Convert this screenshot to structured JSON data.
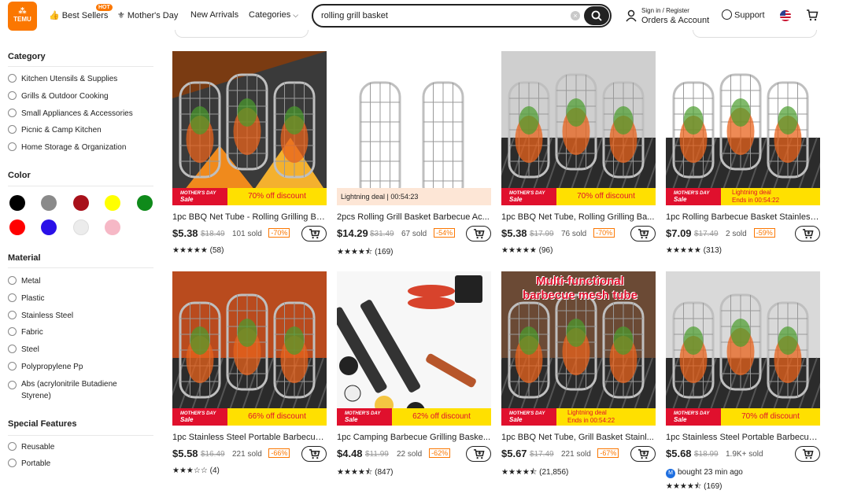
{
  "header": {
    "logo_text": "TEMU",
    "nav": {
      "best_sellers": "Best Sellers",
      "hot_badge": "HOT",
      "mothers_day": "Mother's Day",
      "new_arrivals": "New Arrivals",
      "categories": "Categories"
    },
    "search": {
      "value": "rolling grill basket"
    },
    "account": {
      "small": "Sign in / Register",
      "big": "Orders & Account"
    },
    "support": "Support"
  },
  "sidebar": {
    "category_title": "Category",
    "categories": [
      "Kitchen Utensils & Supplies",
      "Grills & Outdoor Cooking",
      "Small Appliances & Accessories",
      "Picnic & Camp Kitchen",
      "Home Storage & Organization"
    ],
    "color_title": "Color",
    "colors": [
      "#000000",
      "#8a8a8a",
      "#a8101a",
      "#ffff00",
      "#0f8a1a",
      "#ff0000",
      "#2a10e8",
      "#ececec",
      "#f6b8c6"
    ],
    "material_title": "Material",
    "materials": [
      "Metal",
      "Plastic",
      "Stainless Steel",
      "Fabric",
      "Steel",
      "Polypropylene Pp",
      "Abs (acrylonitrile Butadiene Styrene)"
    ],
    "features_title": "Special Features",
    "features": [
      "Reusable",
      "Portable"
    ]
  },
  "banner_common": {
    "mothers_day": "MOTHER'S DAY",
    "sale": "Sale"
  },
  "products": [
    {
      "title": "1pc BBQ Net Tube - Rolling Grilling Ba...",
      "price": "$5.38",
      "old": "$18.49",
      "sold": "101 sold",
      "pct": "-70%",
      "stars": "★★★★★",
      "reviews": "(58)",
      "deal": "70% off discount"
    },
    {
      "title": "2pcs Rolling Grill Basket Barbecue Ac...",
      "price": "$14.29",
      "old": "$31.49",
      "sold": "67 sold",
      "pct": "-54%",
      "stars": "★★★★⯪",
      "reviews": "(169)",
      "lightning": "Lightning deal | 00:54:23"
    },
    {
      "title": "1pc BBQ Net Tube, Rolling Grilling Ba...",
      "price": "$5.38",
      "old": "$17.99",
      "sold": "76 sold",
      "pct": "-70%",
      "stars": "★★★★★",
      "reviews": "(96)",
      "deal": "70% off discount"
    },
    {
      "title": "1pc Rolling Barbecue Basket Stainless...",
      "price": "$7.09",
      "old": "$17.49",
      "sold": "2 sold",
      "pct": "-59%",
      "stars": "★★★★★",
      "reviews": "(313)",
      "deal_line1": "Lightning deal",
      "deal_line2": "Ends in 00:54:22"
    },
    {
      "title": "1pc Stainless Steel Portable Barbecue...",
      "price": "$5.58",
      "old": "$16.49",
      "sold": "221 sold",
      "pct": "-66%",
      "stars": "★★★☆☆",
      "reviews": "(4)",
      "deal": "66% off discount"
    },
    {
      "title": "1pc Camping Barbecue Grilling Baske...",
      "price": "$4.48",
      "old": "$11.99",
      "sold": "22 sold",
      "pct": "-62%",
      "stars": "★★★★⯪",
      "reviews": "(847)",
      "deal": "62% off discount"
    },
    {
      "title": "1pc BBQ Net Tube, Grill Basket Stainl...",
      "price": "$5.67",
      "old": "$17.49",
      "sold": "221 sold",
      "pct": "-67%",
      "stars": "★★★★⯪",
      "reviews": "(21,856)",
      "deal_line1": "Lightning deal",
      "deal_line2": "Ends in 00:54:22",
      "overlay": "Multi-functional barbecue mesh tube"
    },
    {
      "title": "1pc Stainless Steel Portable Barbecue...",
      "price": "$5.68",
      "old": "$18.99",
      "sold": "1.9K+ sold",
      "pct": "",
      "bought_avatar": "M",
      "bought": "bought 23 min ago",
      "stars": "★★★★⯪",
      "reviews": "(169)",
      "deal": "70% off discount"
    }
  ]
}
